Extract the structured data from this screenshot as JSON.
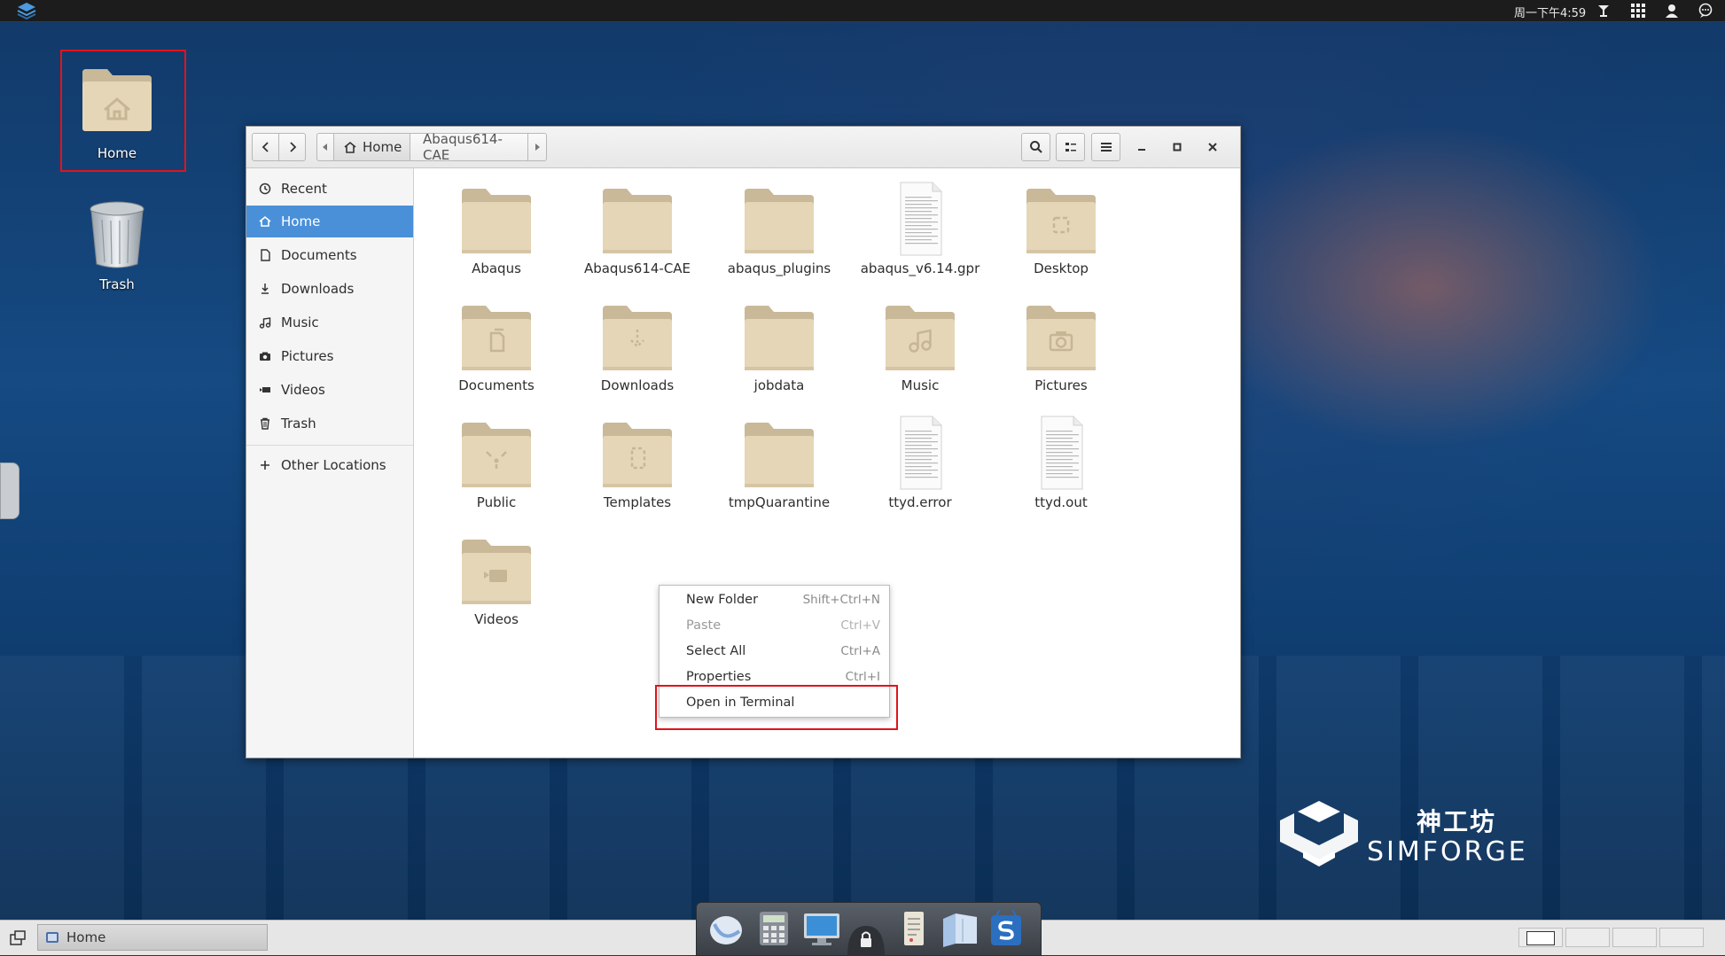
{
  "topbar": {
    "clock": "周一下午4:59",
    "icons": [
      "app-logo-icon",
      "network-icon",
      "apps-grid-icon",
      "user-icon",
      "chat-icon"
    ]
  },
  "desktop": {
    "icons": [
      {
        "label": "Home",
        "icon": "home-folder-icon"
      },
      {
        "label": "Trash",
        "icon": "trash-bin-icon"
      }
    ],
    "brand": {
      "cn": "神工坊",
      "en": "SIMFORGE"
    }
  },
  "window": {
    "path": [
      "Home",
      "Abaqus614-CAE"
    ],
    "controls": [
      "search-icon",
      "view-toggle-icon",
      "menu-icon",
      "minimize-icon",
      "maximize-icon",
      "close-icon"
    ]
  },
  "sidebar": {
    "items": [
      {
        "label": "Recent",
        "icon": "clock-icon",
        "active": false
      },
      {
        "label": "Home",
        "icon": "home-icon",
        "active": true
      },
      {
        "label": "Documents",
        "icon": "document-icon",
        "active": false
      },
      {
        "label": "Downloads",
        "icon": "download-icon",
        "active": false
      },
      {
        "label": "Music",
        "icon": "music-icon",
        "active": false
      },
      {
        "label": "Pictures",
        "icon": "camera-icon",
        "active": false
      },
      {
        "label": "Videos",
        "icon": "video-icon",
        "active": false
      },
      {
        "label": "Trash",
        "icon": "trash-icon",
        "active": false
      }
    ],
    "other": {
      "label": "Other Locations",
      "icon": "plus-icon"
    }
  },
  "files": [
    {
      "name": "Abaqus",
      "type": "folder",
      "emblem": ""
    },
    {
      "name": "Abaqus614-CAE",
      "type": "folder",
      "emblem": ""
    },
    {
      "name": "abaqus_plugins",
      "type": "folder",
      "emblem": ""
    },
    {
      "name": "abaqus_v6.14.gpr",
      "type": "text",
      "emblem": ""
    },
    {
      "name": "Desktop",
      "type": "folder",
      "emblem": "desktop"
    },
    {
      "name": "Documents",
      "type": "folder",
      "emblem": "documents"
    },
    {
      "name": "Downloads",
      "type": "folder",
      "emblem": "downloads"
    },
    {
      "name": "jobdata",
      "type": "folder",
      "emblem": ""
    },
    {
      "name": "Music",
      "type": "folder",
      "emblem": "music"
    },
    {
      "name": "Pictures",
      "type": "folder",
      "emblem": "pictures"
    },
    {
      "name": "Public",
      "type": "folder",
      "emblem": "public"
    },
    {
      "name": "Templates",
      "type": "folder",
      "emblem": "templates"
    },
    {
      "name": "tmpQuarantine",
      "type": "folder",
      "emblem": ""
    },
    {
      "name": "ttyd.error",
      "type": "text",
      "emblem": ""
    },
    {
      "name": "ttyd.out",
      "type": "text",
      "emblem": ""
    },
    {
      "name": "Videos",
      "type": "folder",
      "emblem": "videos"
    }
  ],
  "context_menu": {
    "items": [
      {
        "label": "New Folder",
        "shortcut": "Shift+Ctrl+N",
        "enabled": true
      },
      {
        "label": "Paste",
        "shortcut": "Ctrl+V",
        "enabled": false
      },
      {
        "label": "Select All",
        "shortcut": "Ctrl+A",
        "enabled": true
      },
      {
        "label": "Properties",
        "shortcut": "Ctrl+I",
        "enabled": true
      },
      {
        "label": "Open in Terminal",
        "shortcut": "",
        "enabled": true
      }
    ]
  },
  "taskbar": {
    "task_label": "Home",
    "dock_icons": [
      "browser-icon",
      "calculator-icon",
      "monitor-icon",
      "lock-icon",
      "notes-icon",
      "files-icon",
      "simforge-icon"
    ]
  },
  "colors": {
    "accent": "#4a90d9",
    "highlight": "#e0141c",
    "folder": "#e6d6b8"
  }
}
